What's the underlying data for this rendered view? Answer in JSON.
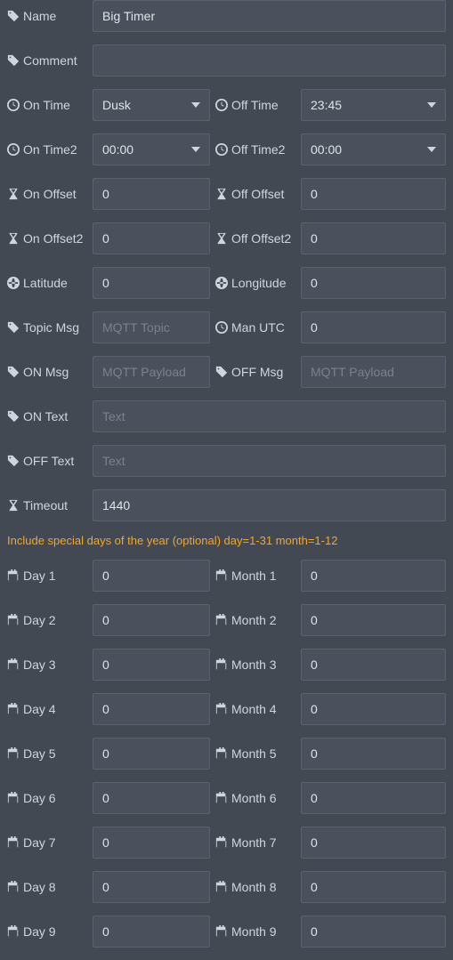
{
  "name": {
    "label": "Name",
    "value": "Big Timer"
  },
  "comment": {
    "label": "Comment",
    "value": ""
  },
  "onTime": {
    "label": "On Time",
    "value": "Dusk"
  },
  "offTime": {
    "label": "Off Time",
    "value": "23:45"
  },
  "onTime2": {
    "label": "On Time2",
    "value": "00:00"
  },
  "offTime2": {
    "label": "Off Time2",
    "value": "00:00"
  },
  "onOffset": {
    "label": "On Offset",
    "value": "0"
  },
  "offOffset": {
    "label": "Off Offset",
    "value": "0"
  },
  "onOffset2": {
    "label": "On Offset2",
    "value": "0"
  },
  "offOffset2": {
    "label": "Off Offset2",
    "value": "0"
  },
  "latitude": {
    "label": "Latitude",
    "value": "0"
  },
  "longitude": {
    "label": "Longitude",
    "value": "0"
  },
  "topicMsg": {
    "label": "Topic Msg",
    "value": "",
    "placeholder": "MQTT Topic"
  },
  "manUtc": {
    "label": "Man UTC",
    "value": "0"
  },
  "onMsg": {
    "label": "ON Msg",
    "value": "",
    "placeholder": "MQTT Payload"
  },
  "offMsg": {
    "label": "OFF Msg",
    "value": "",
    "placeholder": "MQTT Payload"
  },
  "onText": {
    "label": "ON Text",
    "value": "",
    "placeholder": "Text"
  },
  "offText": {
    "label": "OFF Text",
    "value": "",
    "placeholder": "Text"
  },
  "timeout": {
    "label": "Timeout",
    "value": "1440"
  },
  "specialDaysNote": "Include special days of the year (optional) day=1-31 month=1-12",
  "days": [
    {
      "dlabel": "Day 1",
      "dval": "0",
      "mlabel": "Month 1",
      "mval": "0"
    },
    {
      "dlabel": "Day 2",
      "dval": "0",
      "mlabel": "Month 2",
      "mval": "0"
    },
    {
      "dlabel": "Day 3",
      "dval": "0",
      "mlabel": "Month 3",
      "mval": "0"
    },
    {
      "dlabel": "Day 4",
      "dval": "0",
      "mlabel": "Month 4",
      "mval": "0"
    },
    {
      "dlabel": "Day 5",
      "dval": "0",
      "mlabel": "Month 5",
      "mval": "0"
    },
    {
      "dlabel": "Day 6",
      "dval": "0",
      "mlabel": "Month 6",
      "mval": "0"
    },
    {
      "dlabel": "Day 7",
      "dval": "0",
      "mlabel": "Month 7",
      "mval": "0"
    },
    {
      "dlabel": "Day 8",
      "dval": "0",
      "mlabel": "Month 8",
      "mval": "0"
    },
    {
      "dlabel": "Day 9",
      "dval": "0",
      "mlabel": "Month 9",
      "mval": "0"
    }
  ]
}
